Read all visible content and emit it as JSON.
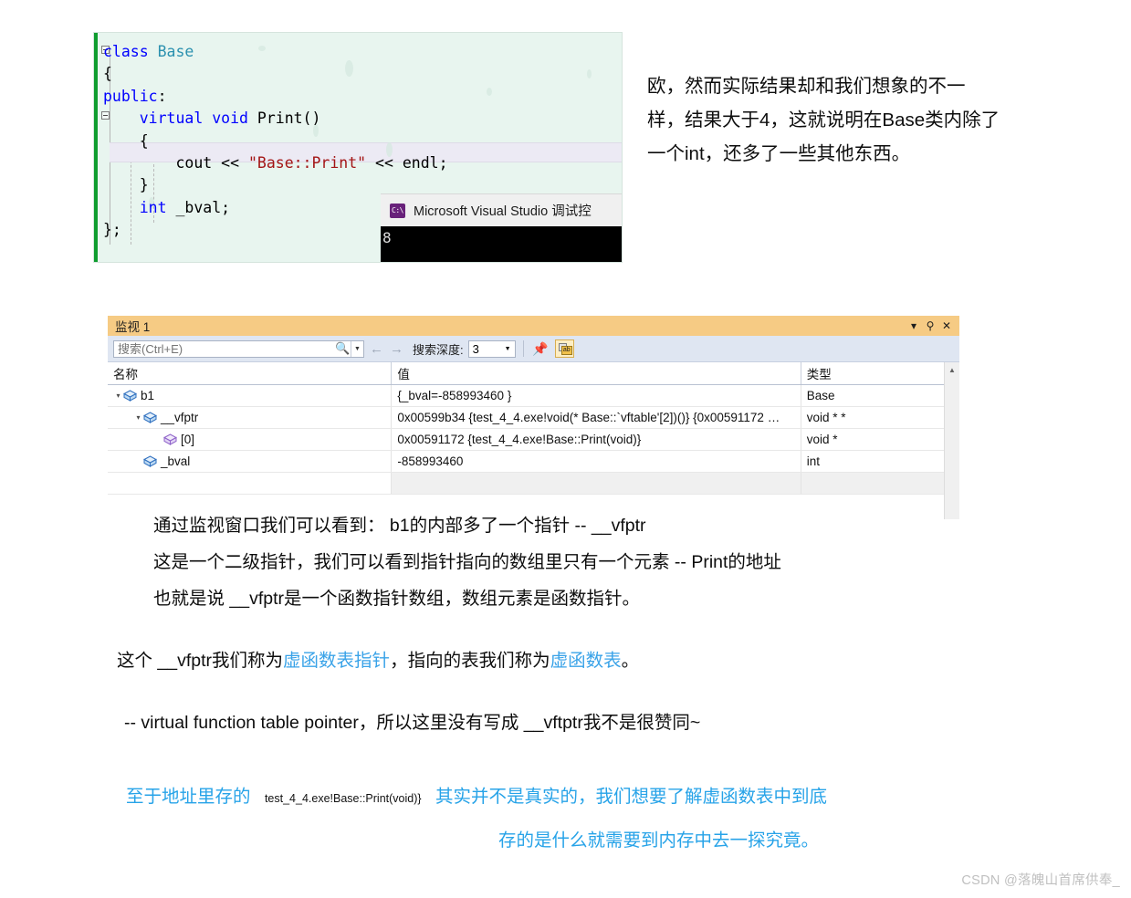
{
  "code_editor": {
    "lines": [
      [
        {
          "t": "class ",
          "c": "blue"
        },
        {
          "t": "Base",
          "c": "type"
        }
      ],
      [
        {
          "t": "{",
          "c": "plain"
        }
      ],
      [
        {
          "t": "public",
          "c": "blue"
        },
        {
          "t": ":",
          "c": "plain"
        }
      ],
      [
        {
          "t": "    ",
          "c": "plain"
        },
        {
          "t": "virtual void ",
          "c": "blue"
        },
        {
          "t": "Print()",
          "c": "plain"
        }
      ],
      [
        {
          "t": "    {",
          "c": "plain"
        }
      ],
      [
        {
          "t": "        cout << ",
          "c": "plain"
        },
        {
          "t": "\"Base::Print\"",
          "c": "str"
        },
        {
          "t": " << endl;",
          "c": "plain"
        }
      ],
      [
        {
          "t": "    }",
          "c": "plain"
        }
      ],
      [
        {
          "t": "    ",
          "c": "plain"
        },
        {
          "t": "int",
          "c": "blue"
        },
        {
          "t": " _bval;",
          "c": "plain"
        }
      ],
      [
        {
          "t": "};",
          "c": "plain"
        }
      ]
    ]
  },
  "console": {
    "title": "Microsoft Visual Studio 调试控",
    "icon_label": "C:\\",
    "output": "8"
  },
  "note_right": {
    "line1": "欧，然而实际结果却和我们想象的不一",
    "line2": "样，结果大于4，这就说明在Base类内除了",
    "line3": "一个int，还多了一些其他东西。"
  },
  "watch": {
    "title": "监视 1",
    "titlebar_buttons": [
      "▾",
      "⚲",
      "✕"
    ],
    "search": {
      "placeholder": "搜索(Ctrl+E)",
      "value": ""
    },
    "nav_back": "←",
    "nav_forward": "→",
    "depth_label": "搜索深度:",
    "depth_value": "3",
    "columns": [
      "名称",
      "值",
      "类型"
    ],
    "rows": [
      {
        "indent": 0,
        "twisty": "▾",
        "icon": "field-cube-blue",
        "name": "b1",
        "value": "{_bval=-858993460 }",
        "type": "Base"
      },
      {
        "indent": 1,
        "twisty": "▾",
        "icon": "field-cube-blue",
        "name": "__vfptr",
        "value": "0x00599b34 {test_4_4.exe!void(* Base::`vftable'[2])()} {0x00591172 …",
        "type": "void * *"
      },
      {
        "indent": 2,
        "twisty": "",
        "icon": "element-cube-purple",
        "name": "[0]",
        "value": "0x00591172 {test_4_4.exe!Base::Print(void)}",
        "type": "void *"
      },
      {
        "indent": 1,
        "twisty": "",
        "icon": "field-cube-blue",
        "name": "_bval",
        "value": "-858993460",
        "type": "int"
      }
    ]
  },
  "body": {
    "p1": "通过监视窗口我们可以看到： b1的内部多了一个指针 -- __vfptr",
    "p2": "这是一个二级指针，我们可以看到指针指向的数组里只有一个元素 -- Print的地址",
    "p3": "也就是说 __vfptr是一个函数指针数组，数组元素是函数指针。",
    "p4_a": "这个 __vfptr我们称为",
    "p4_link1": "虚函数表指针",
    "p4_b": "，指向的表我们称为",
    "p4_link2": "虚函数表",
    "p4_c": "。",
    "p5": "-- virtual function table pointer，所以这里没有写成 __vftptr我不是很赞同~",
    "p6_a": "至于地址里存的",
    "p6_code": "test_4_4.exe!Base::Print(void)}",
    "p6_b": "其实并不是真实的，我们想要了解虚函数表中到底",
    "p6_c": "存的是什么就需要到内存中去一探究竟。"
  },
  "watermark": "CSDN @落魄山首席供奉_",
  "colors": {
    "watch_titlebar": "#f6cb84",
    "toolbar_bg": "#dfe6f2",
    "link_blue": "#3aa3e8",
    "blue_text": "#27a3e8",
    "editor_bg": "#e8f5ef",
    "change_bar_green": "#0f9d2f"
  }
}
